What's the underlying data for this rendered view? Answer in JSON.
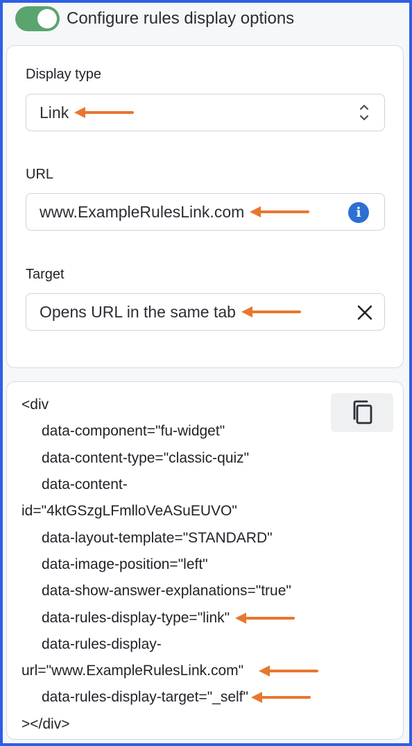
{
  "toggle": {
    "label": "Configure rules display options",
    "on": true
  },
  "display_type": {
    "label": "Display type",
    "value": "Link"
  },
  "url": {
    "label": "URL",
    "value": "www.ExampleRulesLink.com"
  },
  "target": {
    "label": "Target",
    "value": "Opens URL in the same tab"
  },
  "code": {
    "lines": [
      "<div",
      "data-component=\"fu-widget\"",
      "data-content-type=\"classic-quiz\"",
      "data-content-",
      "id=\"4ktGSzgLFmlloVeASuEUVO\"",
      "data-layout-template=\"STANDARD\"",
      "data-image-position=\"left\"",
      "data-show-answer-explanations=\"true\"",
      "data-rules-display-type=\"link\"",
      "data-rules-display-",
      "url=\"www.ExampleRulesLink.com\"",
      "data-rules-display-target=\"_self\"",
      "></div>"
    ]
  },
  "icons": {
    "select": "chevron-up-down-icon",
    "info": "info-icon",
    "clear": "close-icon",
    "copy": "copy-icon",
    "annotation": "arrow-left-icon"
  },
  "colors": {
    "frame": "#2f5fe3",
    "toggle_on": "#5aa46e",
    "info": "#2d6fd3",
    "annotation_arrow": "#e8772e"
  }
}
